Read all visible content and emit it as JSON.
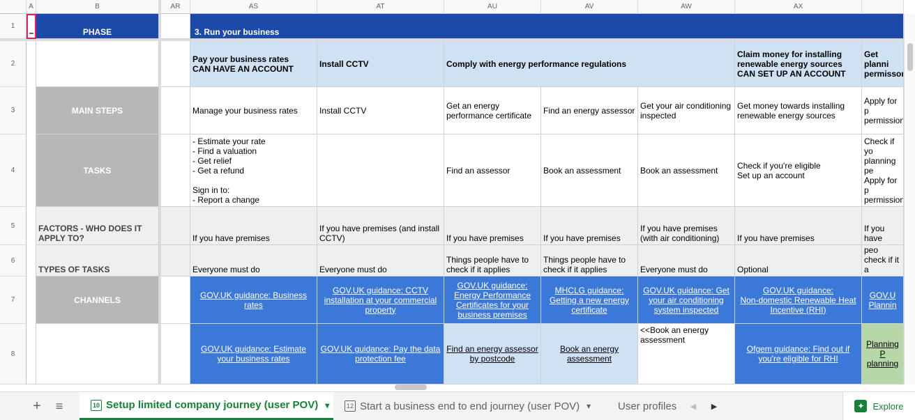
{
  "columns": [
    "A",
    "B",
    "AR",
    "AS",
    "AT",
    "AU",
    "AV",
    "AW",
    "AX"
  ],
  "rows": [
    "1",
    "2",
    "3",
    "4",
    "5",
    "6",
    "7",
    "8"
  ],
  "collapse_toggle": "–",
  "phase_label": "PHASE",
  "phase_value": "3. Run your business",
  "row2": {
    "as": "Pay your business rates\nCAN HAVE AN ACCOUNT",
    "at": "Install CCTV",
    "au": "Comply with energy performance regulations",
    "ax": "Claim money for installing\nrenewable energy sources\nCAN SET UP AN ACCOUNT",
    "ay": "Get planni\npermissor"
  },
  "row3": {
    "label": "MAIN STEPS",
    "as": "Manage your business rates",
    "at": "Install CCTV",
    "au": "Get an energy\nperformance certificate",
    "av": "Find an energy assessor",
    "aw": "Get your air conditioning\ninspected",
    "ax": "Get money towards installing\nrenewable energy sources",
    "ay": "Apply for p\npermission"
  },
  "row4": {
    "label": "TASKS",
    "as": "- Estimate your rate\n- Find a valuation\n- Get relief\n- Get a refund\n\nSign in to:\n- Report a change",
    "au": "Find an assessor",
    "av": "Book an assessment",
    "aw": "Book an assessment",
    "ax": "Check if you're eligible\nSet up an account",
    "ay": "Check if yo\nplanning pe\nApply for p\npermission"
  },
  "row5": {
    "label": "FACTORS - WHO DOES IT\nAPPLY TO?",
    "as": "If you have premises",
    "at": "If you have premises (and install\nCCTV)",
    "au": "If you have premises",
    "av": "If you have premises",
    "aw": "If you have premises\n(with air conditioning)",
    "ax": "If you have premises",
    "ay": "If you have"
  },
  "row6": {
    "label": "TYPES OF TASKS",
    "as": "Everyone must do",
    "at": "Everyone must do",
    "au": "Things people have to\ncheck if it applies",
    "av": "Things people have to\ncheck if it applies",
    "aw": "Everyone must do",
    "ax": "Optional",
    "ay": "Things peo\ncheck if it a"
  },
  "row7": {
    "label": "CHANNELS",
    "as": "GOV.UK guidance: Business\nrates",
    "at": "GOV.UK guidance: CCTV\ninstallation at your commercial\nproperty",
    "au": "GOV.UK guidance:\nEnergy Performance\nCertificates for your\nbusiness premises",
    "av": "MHCLG guidance:\nGetting a new energy\ncertificate",
    "aw": "GOV.UK guidance: Get\nyour air conditioning\nsystem inspected",
    "ax": "GOV.UK guidance:\nNon-domestic Renewable Heat\nIncentive (RHI)",
    "ay": "GOV.U\nPlannin"
  },
  "row8": {
    "as": "GOV.UK guidance: Estimate\nyour business rates",
    "at": "GOV.UK guidance: Pay the data\nprotection fee",
    "au": "Find an energy assessor\nby postcode",
    "av": "Book an energy\nassessment",
    "aw": "<<Book an energy\nassessment",
    "ax": "Ofgem guidance: Find out if\nyou're eligible for RHI",
    "ay": "Planning P\nplanning"
  },
  "tabs": {
    "add": "+",
    "menu": "≡",
    "tab1_num": "10",
    "tab1": "Setup limited company journey (user POV)",
    "tab2_num": "12",
    "tab2": "Start a business end to end journey (user POV)",
    "tab3": "User profiles",
    "prev": "◀",
    "next": "▶",
    "explore": "Explore",
    "dropdown": "▾"
  },
  "colors": {
    "phase_blue": "#1c4aa8",
    "light_blue": "#cfe2f3",
    "link_blue": "#3c78d8",
    "grey": "#b7b7b7",
    "green": "#b6d7a8",
    "accent_green": "#188038"
  }
}
